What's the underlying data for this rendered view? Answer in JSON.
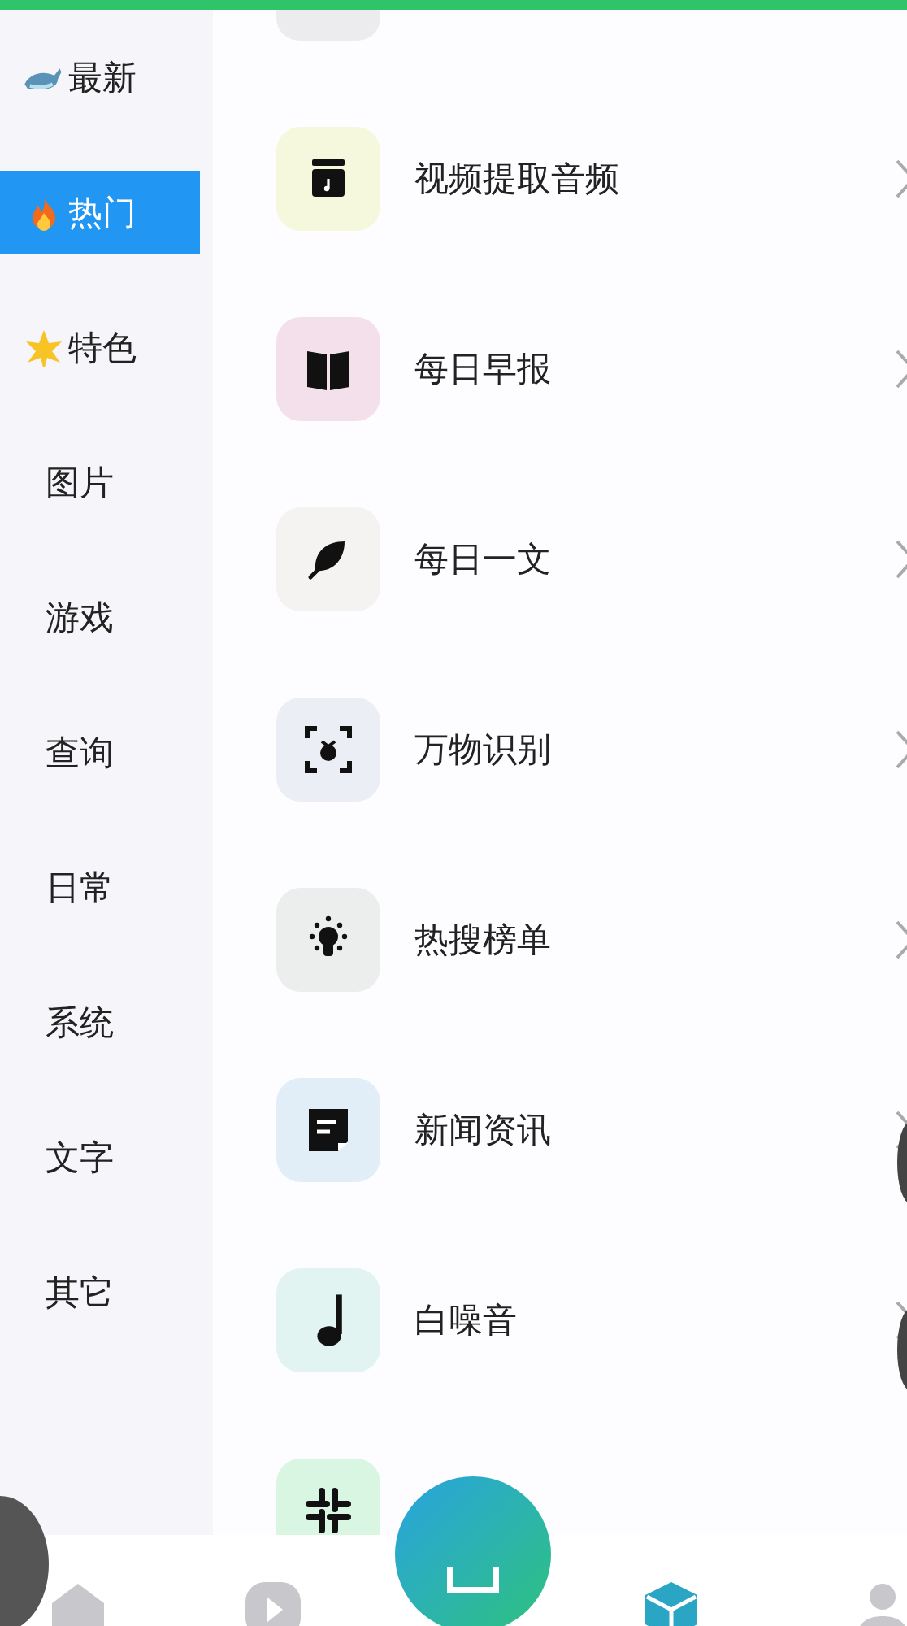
{
  "sidebar": {
    "items": [
      {
        "label": "最新",
        "selected": false
      },
      {
        "label": "热门",
        "selected": true
      },
      {
        "label": "特色",
        "selected": false
      },
      {
        "label": "图片",
        "selected": false
      },
      {
        "label": "游戏",
        "selected": false
      },
      {
        "label": "查询",
        "selected": false
      },
      {
        "label": "日常",
        "selected": false
      },
      {
        "label": "系统",
        "selected": false
      },
      {
        "label": "文字",
        "selected": false
      },
      {
        "label": "其它",
        "selected": false
      }
    ]
  },
  "tools": [
    {
      "label": "视频提取音频",
      "color": "#f5f8dc"
    },
    {
      "label": "每日早报",
      "color": "#f3e0ea"
    },
    {
      "label": "每日一文",
      "color": "#f4f3f1"
    },
    {
      "label": "万物识别",
      "color": "#eceef6"
    },
    {
      "label": "热搜榜单",
      "color": "#eceded"
    },
    {
      "label": "新闻资讯",
      "color": "#e1eef8"
    },
    {
      "label": "白噪音",
      "color": "#e2f4f2"
    },
    {
      "color": "#d9f6e2"
    }
  ]
}
